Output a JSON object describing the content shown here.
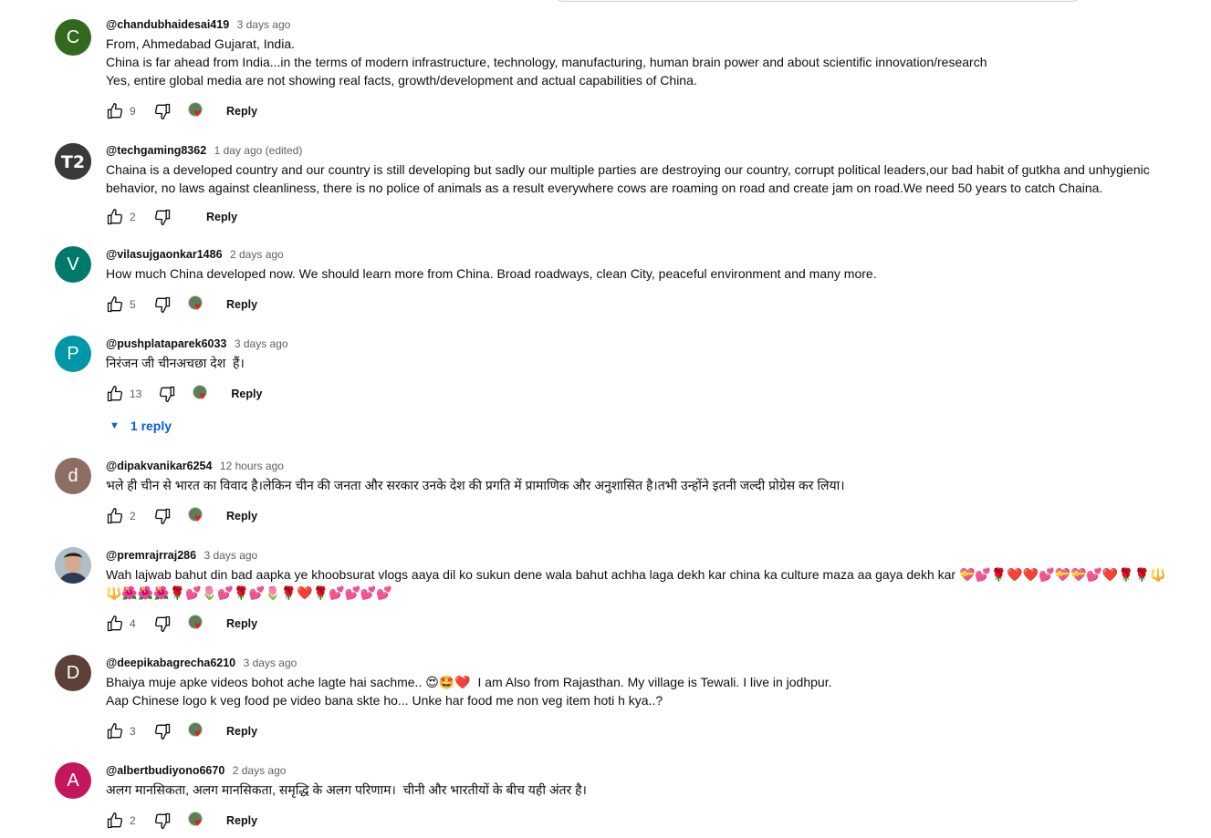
{
  "comments": [
    {
      "author": "@chandubhaidesai419",
      "time": "3 days ago",
      "avatar_letter": "C",
      "avatar_color": "#33691e",
      "text": "From, Ahmedabad Gujarat, India.\nChina is far ahead from India...in the terms of modern infrastructure, technology, manufacturing, human brain power and about scientific innovation/research\nYes, entire global media are not showing real facts, growth/development and actual capabilities of China.",
      "likes": "9",
      "reply_label": "Reply",
      "creator_heart": true
    },
    {
      "author": "@techgaming8362",
      "time": "1 day ago (edited)",
      "avatar_letter": "T2",
      "avatar_color": "#3a3a3a",
      "text": "Chaina is a developed country and our country is still developing but sadly our multiple parties are destroying our country, corrupt political leaders,our bad habit of gutkha and unhygienic behavior, no laws against cleanliness, there is no police of animals as a result everywhere cows are roaming on road and create jam on road.We need 50 years to catch Chaina.",
      "likes": "2",
      "reply_label": "Reply",
      "creator_heart": false
    },
    {
      "author": "@vilasujgaonkar1486",
      "time": "2 days ago",
      "avatar_letter": "V",
      "avatar_color": "#00796b",
      "text": "How much China developed now. We should learn more from China. Broad roadways, clean City, peaceful environment and many more.",
      "likes": "5",
      "reply_label": "Reply",
      "creator_heart": true
    },
    {
      "author": "@pushplataparek6033",
      "time": "3 days ago",
      "avatar_letter": "P",
      "avatar_color": "#0097a7",
      "text": "निरंजन जी चीनअचछा देश  हैं।",
      "likes": "13",
      "reply_label": "Reply",
      "creator_heart": true
    },
    {
      "author": "@dipakvanikar6254",
      "time": "12 hours ago",
      "avatar_letter": "d",
      "avatar_color": "#8d6e63",
      "text": "भले ही चीन से भारत का विवाद है।लेकिन चीन की जनता और सरकार उनके देश की प्रगति में प्रामाणिक और अनुशासित है।तभी उन्होंने इतनी जल्दी प्रोग्रेस कर लिया।",
      "likes": "2",
      "reply_label": "Reply",
      "creator_heart": true
    },
    {
      "author": "@premrajrraj286",
      "time": "3 days ago",
      "avatar_letter": "",
      "avatar_color": "#9e9e9e",
      "text": "Wah lajwab bahut din bad aapka ye khoobsurat vlogs aaya dil ko sukun dene wala bahut achha laga dekh kar china ka culture maza aa gaya dekh kar 💝💕🌹❤️❤️💕💝💝💕❤️🌹🌹🔱\n🔱🌺🌺🌺🌹💕🌷💕🌹💕🌷🌹❤️🌹💕💕💕💕",
      "likes": "4",
      "reply_label": "Reply",
      "creator_heart": true
    },
    {
      "author": "@deepikabagrecha6210",
      "time": "3 days ago",
      "avatar_letter": "D",
      "avatar_color": "#5d4037",
      "text": "Bhaiya muje apke videos bohot ache lagte hai sachme.. 😍🤩❤️  I am Also from Rajasthan. My village is Tewali. I live in jodhpur.\nAap Chinese logo k veg food pe video bana skte ho... Unke har food me non veg item hoti h kya..?",
      "likes": "3",
      "reply_label": "Reply",
      "creator_heart": true
    },
    {
      "author": "@albertbudiyono6670",
      "time": "2 days ago",
      "avatar_letter": "A",
      "avatar_color": "#c2185b",
      "text": "अलग मानसिकता, अलग मानसिकता, समृद्धि के अलग परिणाम।  चीनी और भारतीयों के बीच यही अंतर है।",
      "likes": "2",
      "reply_label": "Reply",
      "creator_heart": true
    }
  ],
  "replies_toggle": {
    "label": "1 reply",
    "color": "#065fd4"
  },
  "icons": {
    "like": "thumb-up-icon",
    "dislike": "thumb-down-icon",
    "creator_heart": "creator-heart-icon",
    "expand": "chevron-down-icon"
  }
}
